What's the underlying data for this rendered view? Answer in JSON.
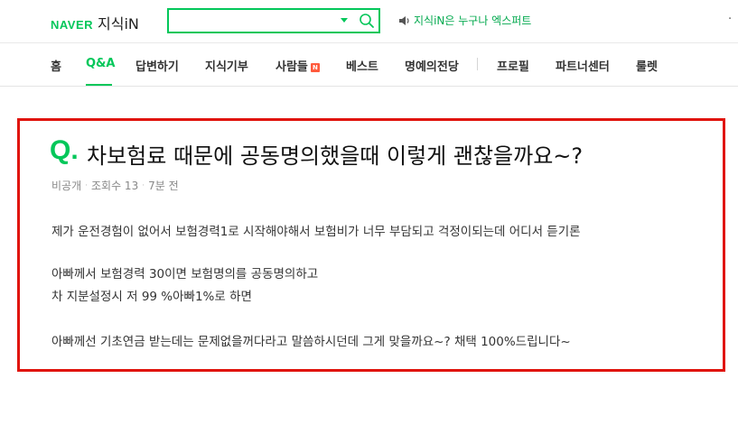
{
  "header": {
    "logo_naver": "NAVER",
    "logo_jisik": "지식iN",
    "search_value": "",
    "promo_text": "지식iN은 누구나 엑스퍼트"
  },
  "nav": {
    "items": [
      "홈",
      "Q&A",
      "답변하기",
      "지식기부",
      "사람들",
      "베스트",
      "명예의전당",
      "프로필",
      "파트너센터",
      "룰렛"
    ],
    "badge": "N",
    "active": "Q&A"
  },
  "question": {
    "q_mark": "Q.",
    "title": "차보험료 때문에 공동명의했을때 이렇게 괜찮을까요~?",
    "meta": {
      "privacy": "비공개",
      "views": "조회수 13",
      "time": "7분 전"
    },
    "body": [
      "제가 운전경험이 없어서 보험경력1로 시작해야해서 보험비가 너무 부담되고 걱정이되는데 어디서 듣기론",
      "아빠께서 보험경력 30이면 보험명의를 공동명의하고",
      "차 지분설정시 저 99 %아빠1%로 하면",
      "아빠께선 기초연금 받는데는 문제없을꺼다라고 말씀하시던데 그게 맞을까요~? 채택 100%드립니다~"
    ]
  },
  "colors": {
    "brand_green": "#03c75a",
    "highlight_red": "#e0140c"
  }
}
